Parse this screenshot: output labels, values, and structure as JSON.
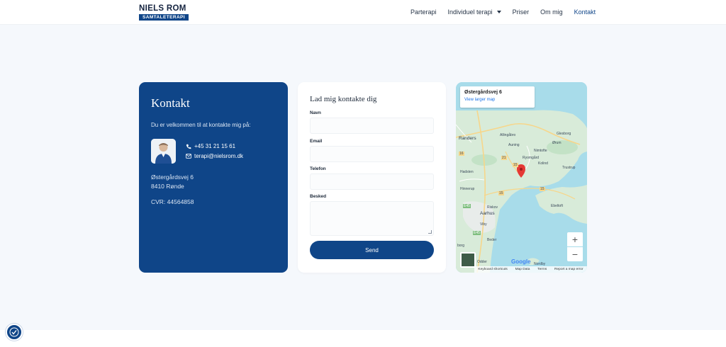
{
  "brand": {
    "name": "NIELS ROM",
    "tagline": "SAMTALETERAPI"
  },
  "nav": [
    {
      "label": "Parterapi"
    },
    {
      "label": "Individuel terapi",
      "has_dropdown": true
    },
    {
      "label": "Priser"
    },
    {
      "label": "Om mig"
    },
    {
      "label": "Kontakt",
      "active": true
    }
  ],
  "contact": {
    "title": "Kontakt",
    "intro": "Du er velkommen til at kontakte mig på:",
    "phone": "+45 31 21 15 61",
    "email": "terapi@nielsrom.dk",
    "address_line1": "Østergårdsvej 6",
    "address_line2": "8410 Rønde",
    "cvr": "CVR: 44564858"
  },
  "form": {
    "title": "Lad mig kontakte dig",
    "fields": [
      {
        "label": "Navn"
      },
      {
        "label": "Email"
      },
      {
        "label": "Telefon"
      },
      {
        "label": "Besked"
      }
    ],
    "submit_label": "Send"
  },
  "map": {
    "place_title": "Østergårdsvej 6",
    "larger_map_link": "View larger map",
    "labels": {
      "randers": "Randers",
      "allingabro": "Allingåbro",
      "glesborg": "Glesborg",
      "orum": "Ørum",
      "auning": "Auning",
      "nimtofte": "Nimtofte",
      "ryomgard": "Ryomgård",
      "kolind": "Kolind",
      "hadsten": "Hadsten",
      "trustrup": "Trustrup",
      "hinnerup": "Hinnerup",
      "ebeltoft": "Ebeltoft",
      "riskov": "Riskov",
      "aarhus": "Aarhus",
      "viby": "Viby",
      "beder": "Beder",
      "borg": "borg",
      "odder": "Odder",
      "nordby": "Nordby"
    },
    "road_numbers": [
      "16",
      "21",
      "15",
      "15",
      "E45",
      "E45",
      "15"
    ],
    "google_logo": "Google",
    "footer": {
      "shortcuts": "Keyboard shortcuts",
      "map_data": "Map Data",
      "terms": "Terms",
      "report": "Report a map error"
    },
    "zoom_in": "+",
    "zoom_out": "−"
  },
  "colors": {
    "primary": "#0f4588",
    "page_bg": "#f5f8fc",
    "water": "#a8dcea",
    "land": "#d8ebd9",
    "marker": "#e53935"
  },
  "icons": {
    "phone": "phone-icon",
    "email": "email-icon",
    "marker": "map-marker-icon",
    "accessibility": "accessibility-icon"
  }
}
